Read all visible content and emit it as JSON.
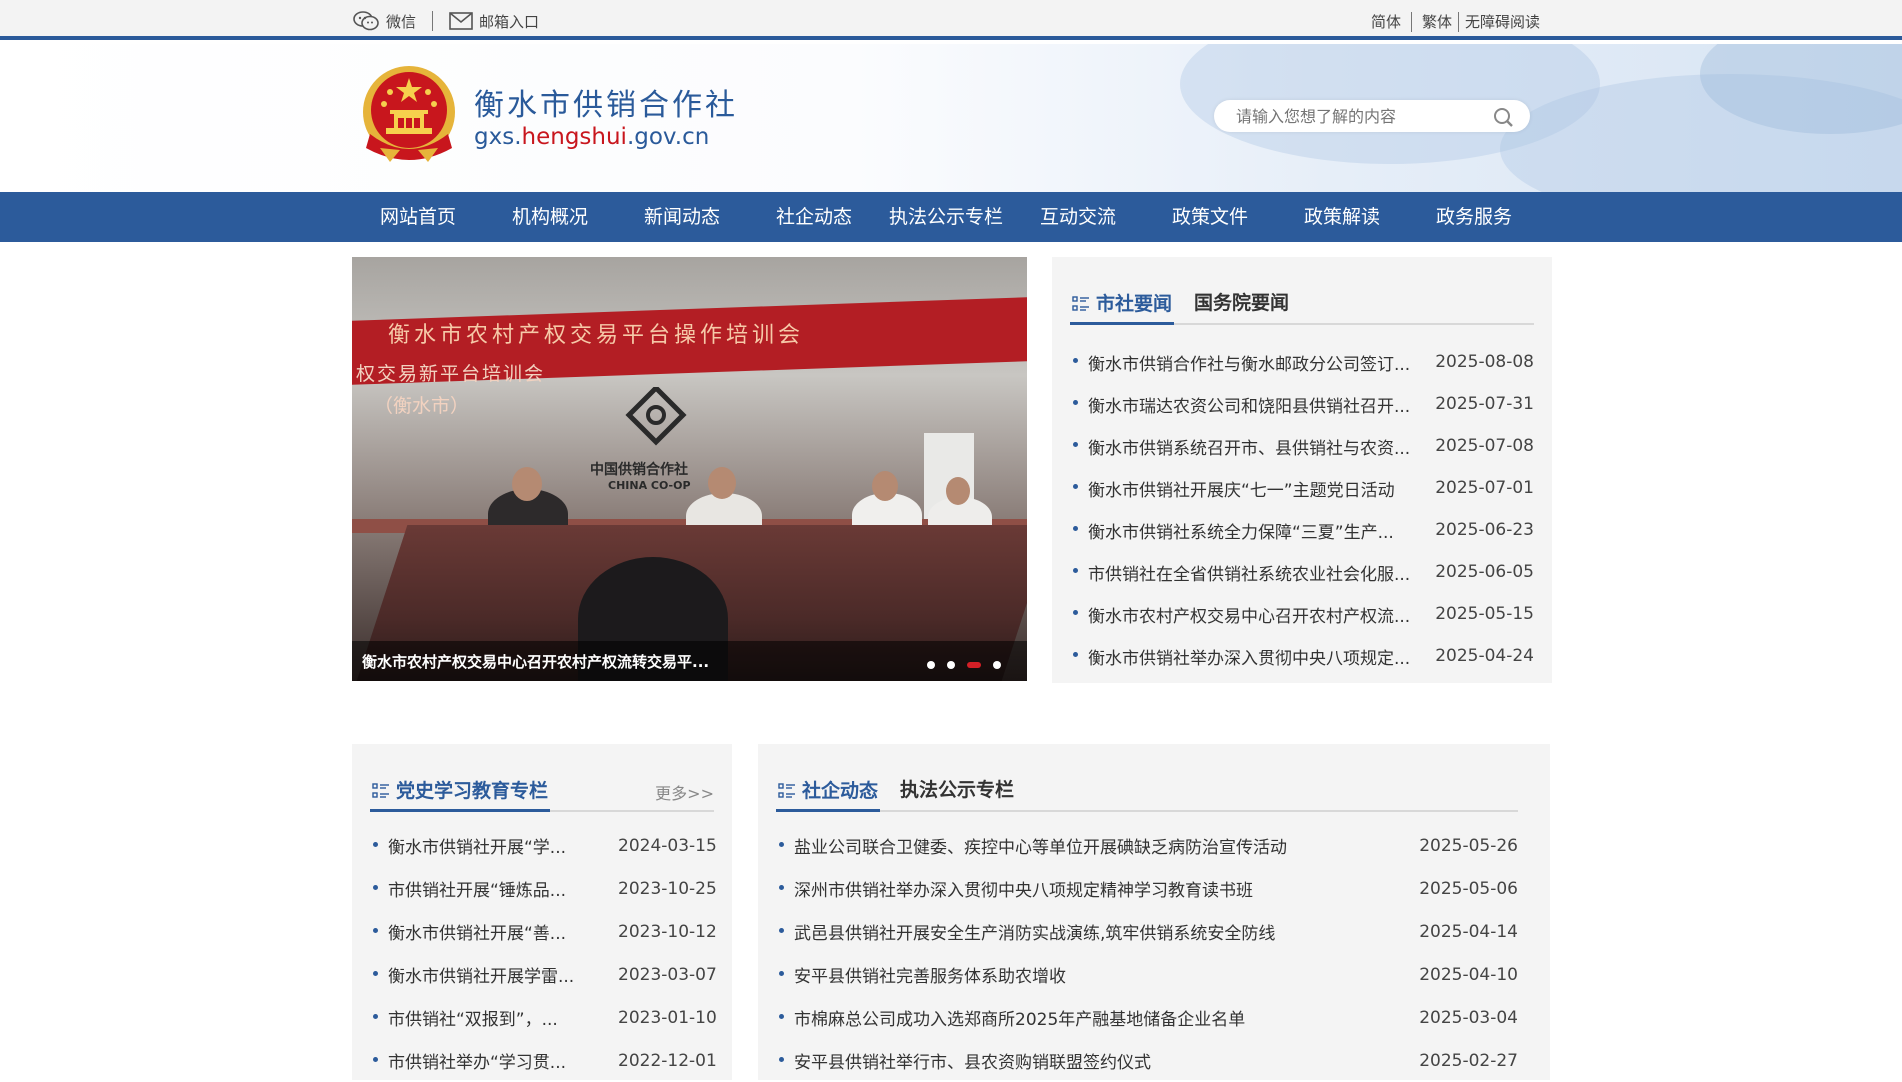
{
  "topbar": {
    "wechat": "微信",
    "mailbox": "邮箱入口",
    "simplified": "简体",
    "traditional": "繁体",
    "accessible": "无障碍阅读"
  },
  "header": {
    "site_name": "衡水市供销合作社",
    "domain_prefix": "gxs.",
    "domain_highlight": "hengshui",
    "domain_suffix": ".gov.cn",
    "search_placeholder": "请输入您想了解的内容"
  },
  "nav": {
    "items": [
      "网站首页",
      "机构概况",
      "新闻动态",
      "社企动态",
      "执法公示专栏",
      "互动交流",
      "政策文件",
      "政策解读",
      "政务服务"
    ]
  },
  "slider": {
    "banner": "衡水市农村产权交易平台操作培训会",
    "banner_sub": "权交易新平台培训会",
    "banner_sub2": "（衡水市）",
    "logo_cn": "中国供销合作社",
    "logo_en": "CHINA CO-OP",
    "caption": "衡水市农村产权交易中心召开农村产权流转交易平..."
  },
  "news_panel": {
    "tabs": [
      "市社要闻",
      "国务院要闻"
    ],
    "items": [
      {
        "title": "衡水市供销合作社与衡水邮政分公司签订...",
        "date": "2025-08-08"
      },
      {
        "title": "衡水市瑞达农资公司和饶阳县供销社召开...",
        "date": "2025-07-31"
      },
      {
        "title": "衡水市供销系统召开市、县供销社与农资...",
        "date": "2025-07-08"
      },
      {
        "title": "衡水市供销社开展庆“七一”主题党日活动",
        "date": "2025-07-01"
      },
      {
        "title": "衡水市供销社系统全力保障“三夏”生产...",
        "date": "2025-06-23"
      },
      {
        "title": "市供销社在全省供销社系统农业社会化服...",
        "date": "2025-06-05"
      },
      {
        "title": "衡水市农村产权交易中心召开农村产权流...",
        "date": "2025-05-15"
      },
      {
        "title": "衡水市供销社举办深入贯彻中央八项规定...",
        "date": "2025-04-24"
      }
    ]
  },
  "party_panel": {
    "tab": "党史学习教育专栏",
    "more": "更多>>",
    "items": [
      {
        "title": "衡水市供销社开展“学...",
        "date": "2024-03-15"
      },
      {
        "title": "市供销社开展“锤炼品...",
        "date": "2023-10-25"
      },
      {
        "title": "衡水市供销社开展“善...",
        "date": "2023-10-12"
      },
      {
        "title": "衡水市供销社开展学雷...",
        "date": "2023-03-07"
      },
      {
        "title": "市供销社“双报到”，...",
        "date": "2023-01-10"
      },
      {
        "title": "市供销社举办“学习贯...",
        "date": "2022-12-01"
      }
    ]
  },
  "social_panel": {
    "tabs": [
      "社企动态",
      "执法公示专栏"
    ],
    "items": [
      {
        "title": "盐业公司联合卫健委、疾控中心等单位开展碘缺乏病防治宣传活动",
        "date": "2025-05-26"
      },
      {
        "title": "深州市供销社举办深入贯彻中央八项规定精神学习教育读书班",
        "date": "2025-05-06"
      },
      {
        "title": "武邑县供销社开展安全生产消防实战演练,筑牢供销系统安全防线",
        "date": "2025-04-14"
      },
      {
        "title": "安平县供销社完善服务体系助农增收",
        "date": "2025-04-10"
      },
      {
        "title": "市棉麻总公司成功入选郑商所2025年产融基地储备企业名单",
        "date": "2025-03-04"
      },
      {
        "title": "安平县供销社举行市、县农资购销联盟签约仪式",
        "date": "2025-02-27"
      }
    ]
  },
  "colors": {
    "brand_blue": "#2c5b9b",
    "accent_red": "#c8161d"
  }
}
